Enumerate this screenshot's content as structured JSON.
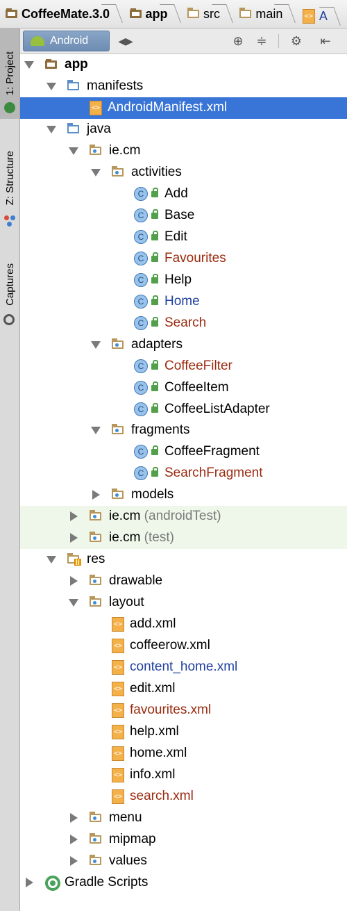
{
  "breadcrumb": [
    "CoffeeMate.3.0",
    "app",
    "src",
    "main",
    "A"
  ],
  "sidebar": {
    "tabs": [
      {
        "label": "1: Project",
        "icon": "android-icon"
      },
      {
        "label": "Z: Structure",
        "icon": "structure-icon"
      },
      {
        "label": "Captures",
        "icon": "camera-icon"
      }
    ]
  },
  "toolbar": {
    "view_label": "Android",
    "icons": [
      "sync-icon",
      "collapse-icon",
      "gear-icon",
      "hide-icon"
    ]
  },
  "tree": [
    {
      "label": "app",
      "type": "app",
      "expanded": true
    },
    {
      "label": "manifests",
      "type": "folder-blue",
      "expanded": true
    },
    {
      "label": "AndroidManifest.xml",
      "type": "xml",
      "selected": true
    },
    {
      "label": "java",
      "type": "folder-blue",
      "expanded": true
    },
    {
      "label": "ie.cm",
      "type": "package",
      "expanded": true
    },
    {
      "label": "activities",
      "type": "package",
      "expanded": true
    },
    {
      "label": "Add",
      "type": "class"
    },
    {
      "label": "Base",
      "type": "class"
    },
    {
      "label": "Edit",
      "type": "class"
    },
    {
      "label": "Favourites",
      "type": "class",
      "color": "red"
    },
    {
      "label": "Help",
      "type": "class"
    },
    {
      "label": "Home",
      "type": "class",
      "color": "blue"
    },
    {
      "label": "Search",
      "type": "class",
      "color": "red"
    },
    {
      "label": "adapters",
      "type": "package",
      "expanded": true
    },
    {
      "label": "CoffeeFilter",
      "type": "class",
      "color": "red"
    },
    {
      "label": "CoffeeItem",
      "type": "class"
    },
    {
      "label": "CoffeeListAdapter",
      "type": "class"
    },
    {
      "label": "fragments",
      "type": "package",
      "expanded": true
    },
    {
      "label": "CoffeeFragment",
      "type": "class"
    },
    {
      "label": "SearchFragment",
      "type": "class",
      "color": "red"
    },
    {
      "label": "models",
      "type": "package",
      "expanded": false
    },
    {
      "label": "ie.cm",
      "suffix": "(androidTest)",
      "type": "package",
      "expanded": false,
      "green": true
    },
    {
      "label": "ie.cm",
      "suffix": "(test)",
      "type": "package",
      "expanded": false,
      "green": true
    },
    {
      "label": "res",
      "type": "res",
      "expanded": true
    },
    {
      "label": "drawable",
      "type": "package",
      "expanded": false
    },
    {
      "label": "layout",
      "type": "package",
      "expanded": true
    },
    {
      "label": "add.xml",
      "type": "xml"
    },
    {
      "label": "coffeerow.xml",
      "type": "xml"
    },
    {
      "label": "content_home.xml",
      "type": "xml",
      "color": "blue"
    },
    {
      "label": "edit.xml",
      "type": "xml"
    },
    {
      "label": "favourites.xml",
      "type": "xml",
      "color": "red"
    },
    {
      "label": "help.xml",
      "type": "xml"
    },
    {
      "label": "home.xml",
      "type": "xml"
    },
    {
      "label": "info.xml",
      "type": "xml"
    },
    {
      "label": "search.xml",
      "type": "xml",
      "color": "red"
    },
    {
      "label": "menu",
      "type": "package",
      "expanded": false
    },
    {
      "label": "mipmap",
      "type": "package",
      "expanded": false
    },
    {
      "label": "values",
      "type": "package",
      "expanded": false
    },
    {
      "label": "Gradle Scripts",
      "type": "gradle",
      "expanded": false
    }
  ]
}
